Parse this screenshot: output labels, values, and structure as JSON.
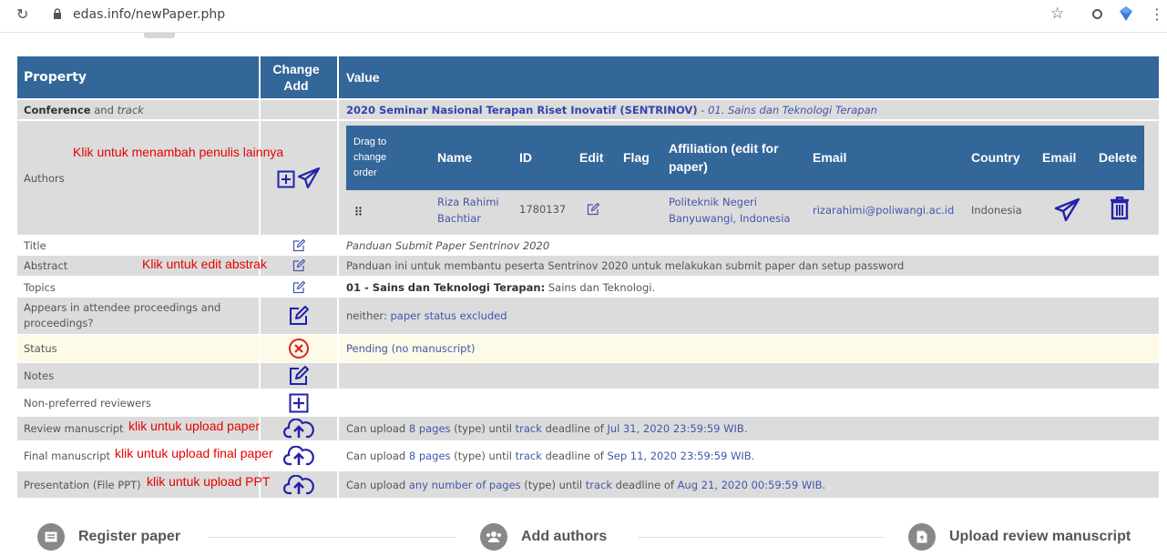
{
  "browser": {
    "url": "edas.info/newPaper.php"
  },
  "header": {
    "property": "Property",
    "change": "Change",
    "add": "Add",
    "value": "Value"
  },
  "rows": {
    "conference": {
      "prop_bold": "Conference",
      "prop_and": " and ",
      "prop_track": "track",
      "value_main": "2020 Seminar Nasional Terapan Riset Inovatif (SENTRINOV)",
      "value_sep": " - ",
      "value_track": "01. Sains dan Teknologi Terapan"
    },
    "authors": {
      "prop": "Authors",
      "hint": "Klik untuk menambah penulis lainnya",
      "columns": {
        "drag": "Drag to change order",
        "name": "Name",
        "id": "ID",
        "edit": "Edit",
        "flag": "Flag",
        "affiliation": "Affiliation (edit for paper)",
        "email": "Email",
        "country": "Country",
        "email_action": "Email",
        "delete": "Delete"
      },
      "author": {
        "name": "Riza Rahimi Bachtiar",
        "id": "1780137",
        "affiliation": "Politeknik Negeri Banyuwangi, Indonesia",
        "email": "rizarahimi@poliwangi.ac.id",
        "country": "Indonesia"
      }
    },
    "title": {
      "prop": "Title",
      "value": "Panduan Submit Paper Sentrinov 2020"
    },
    "abstract": {
      "prop": "Abstract",
      "hint": "Klik untuk edit abstrak",
      "value": "Panduan ini untuk membantu peserta Sentrinov 2020 untuk melakukan submit paper dan setup password"
    },
    "topics": {
      "prop": "Topics",
      "value_bold": "01 - Sains dan Teknologi Terapan:",
      "value_rest": " Sains dan Teknologi."
    },
    "appears": {
      "prop": "Appears in attendee proceedings and proceedings?",
      "value_pre": "neither: ",
      "value_link": "paper status excluded"
    },
    "status": {
      "prop": "Status",
      "value": "Pending (no manuscript)"
    },
    "notes": {
      "prop": "Notes"
    },
    "nonpref": {
      "prop": "Non-preferred reviewers"
    },
    "review": {
      "prop": "Review manuscript",
      "hint": "klik untuk upload paper",
      "v1": "Can upload ",
      "pages": "8 pages",
      "v2": " (type) until ",
      "track": "track",
      "v3": " deadline of ",
      "deadline": "Jul 31, 2020 23:59:59 WIB",
      "v4": "."
    },
    "final": {
      "prop": "Final manuscript",
      "hint": "klik untuk upload final paper",
      "v1": "Can upload ",
      "pages": "8 pages",
      "v2": " (type) until ",
      "track": "track",
      "v3": " deadline of ",
      "deadline": "Sep 11, 2020 23:59:59 WIB",
      "v4": "."
    },
    "presentation": {
      "prop": "Presentation (File PPT)",
      "hint": "klik untuk upload PPT",
      "v1": "Can upload ",
      "pages": "any number of pages",
      "v2": " (type) until ",
      "track": "track",
      "v3": " deadline of ",
      "deadline": "Aug 21, 2020 00:59:59 WIB",
      "v4": "."
    }
  },
  "steps": {
    "register": "Register paper",
    "add_authors": "Add authors",
    "upload_review": "Upload review manuscript"
  },
  "colors": {
    "header": "#336699",
    "row_gray": "#dcdcdc",
    "status_row": "#fdfbe8",
    "icon": "#2222aa",
    "status_icon": "#dd2222",
    "hint": "#e60000"
  }
}
